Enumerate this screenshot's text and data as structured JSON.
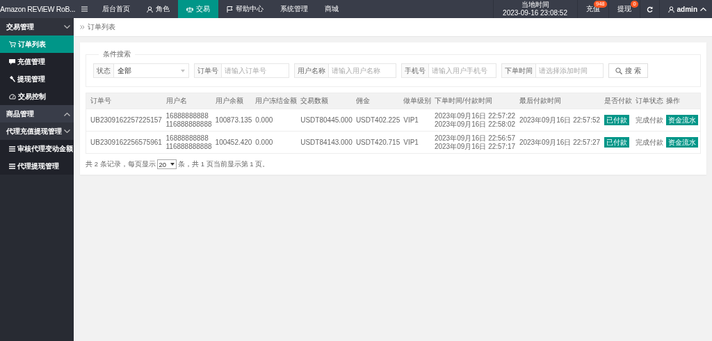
{
  "app_title": "Amazon REViEW RoB...",
  "nav": [
    {
      "label": "后台首页",
      "selected": false
    },
    {
      "label": "角色",
      "selected": false
    },
    {
      "label": "交易",
      "selected": true
    },
    {
      "label": "帮助中心",
      "selected": false
    },
    {
      "label": "系统管理",
      "selected": false
    },
    {
      "label": "商城",
      "selected": false
    }
  ],
  "clock": {
    "label": "当地时间",
    "value": "2023-09-16 23:08:52"
  },
  "top_actions": [
    {
      "label": "充值",
      "badge": "948"
    },
    {
      "label": "提现",
      "badge": "0"
    }
  ],
  "user": {
    "name": "admin"
  },
  "sidebar": [
    {
      "label": "交易管理",
      "expanded": true,
      "children": [
        {
          "label": "订单列表",
          "selected": true
        },
        {
          "label": "充值管理",
          "selected": false
        },
        {
          "label": "提现管理",
          "selected": false
        },
        {
          "label": "交易控制",
          "selected": false
        }
      ]
    },
    {
      "label": "商品管理",
      "expanded": false
    },
    {
      "label": "代理充值提现管理",
      "expanded": true,
      "children": [
        {
          "label": "审核代理变动金额",
          "selected": false
        },
        {
          "label": "代理提现管理",
          "selected": false
        }
      ]
    }
  ],
  "breadcrumb": "订单列表",
  "search": {
    "legend": "条件搜索",
    "button": "搜 索",
    "fields": [
      {
        "kind": "select",
        "label": "状态",
        "value": "全部"
      },
      {
        "kind": "input",
        "label": "订单号",
        "placeholder": "请输入订单号"
      },
      {
        "kind": "input",
        "label": "用户名称",
        "placeholder": "请输入用户名称"
      },
      {
        "kind": "input",
        "label": "手机号",
        "placeholder": "请输入用户手机号"
      },
      {
        "kind": "input",
        "label": "下单时间",
        "placeholder": "请选择添加时间"
      }
    ]
  },
  "table": {
    "columns": [
      "订单号",
      "用户名",
      "用户余额",
      "用户冻结金额",
      "交易数额",
      "佣金",
      "做单级别",
      "下单时间/付款时间",
      "最后付款时间",
      "是否付款",
      "订单状态",
      "操作"
    ],
    "rows": [
      {
        "order_no": "UB2309162257225157",
        "username": [
          "16888888888",
          "116888888888"
        ],
        "balance": "100873.135",
        "frozen": "0.000",
        "amount": "USDT80445.000",
        "commission": "USDT402.225",
        "level": "VIP1",
        "times": [
          "2023年09月16日 22:57:22",
          "2023年09月16日 22:58:02"
        ],
        "last_paid": "2023年09月16日 22:57:52",
        "paid": "已付款",
        "status": "完成付款",
        "action": "资金流水"
      },
      {
        "order_no": "UB2309162256575961",
        "username": [
          "16888888888",
          "116888888888"
        ],
        "balance": "100452.420",
        "frozen": "0.000",
        "amount": "USDT84143.000",
        "commission": "USDT420.715",
        "level": "VIP1",
        "times": [
          "2023年09月16日 22:56:57",
          "2023年09月16日 22:57:17"
        ],
        "last_paid": "2023年09月16日 22:57:27",
        "paid": "已付款",
        "status": "完成付款",
        "action": "资金流水"
      }
    ]
  },
  "pagination": {
    "before": "共 2 条记录，每页显示",
    "page_size": "20",
    "after": "条，共 1 页当前显示第 1 页。"
  }
}
